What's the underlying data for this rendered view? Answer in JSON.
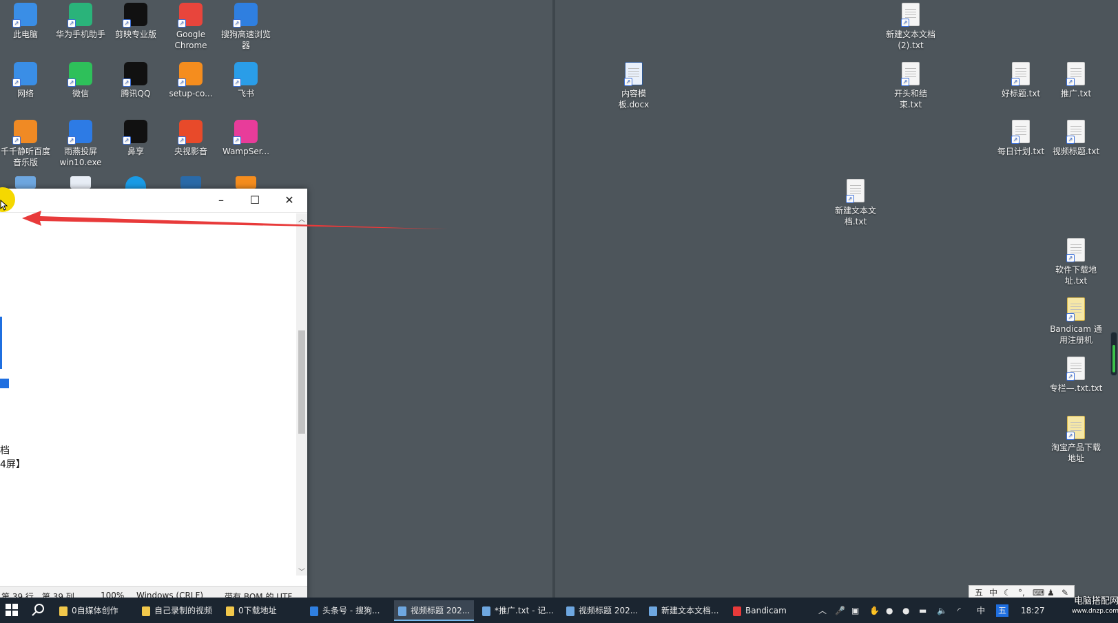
{
  "colors": {
    "desktop_left": "#4f575d",
    "desktop_right": "#4d555b",
    "taskbar": "#1b2530",
    "arrow": "#e83a3a",
    "cursor_highlight": "#f5d800",
    "accent": "#76b9ed"
  },
  "desktop_left_icons": [
    {
      "label": "此电脑",
      "icon": "computer-icon",
      "color": "#3a8ee6"
    },
    {
      "label": "华为手机助手",
      "icon": "huawei-assistant-icon",
      "color": "#2ab37a"
    },
    {
      "label": "剪映专业版",
      "icon": "jianying-icon",
      "color": "#111111"
    },
    {
      "label": "Google Chrome",
      "icon": "chrome-icon",
      "color": "#e8453c"
    },
    {
      "label": "搜狗高速浏览器",
      "icon": "sogou-browser-icon",
      "color": "#2f7fe0"
    },
    {
      "label": "网络",
      "icon": "network-icon",
      "color": "#3a8ee6"
    },
    {
      "label": "微信",
      "icon": "wechat-icon",
      "color": "#2ec05a"
    },
    {
      "label": "腾讯QQ",
      "icon": "qq-icon",
      "color": "#111111"
    },
    {
      "label": "setup-co...",
      "icon": "sublime-icon",
      "color": "#f58d1e"
    },
    {
      "label": "飞书",
      "icon": "feishu-icon",
      "color": "#2a9de8"
    },
    {
      "label": "千千静听百度音乐版",
      "icon": "ttplayer-icon",
      "color": "#f08a24"
    },
    {
      "label": "雨燕投屏win10.exe",
      "icon": "screen-cast-icon",
      "color": "#2d7be5"
    },
    {
      "label": "鼻享",
      "icon": "bixiang-icon",
      "color": "#111111"
    },
    {
      "label": "央视影音",
      "icon": "cctv-icon",
      "color": "#e84a2a"
    },
    {
      "label": "WampSer...",
      "icon": "wampserver-icon",
      "color": "#e83c9a"
    }
  ],
  "desktop_right_icons": [
    {
      "label": "新建文本文档 (2).txt",
      "icon": "text-file-icon"
    },
    {
      "label": "内容模板.docx",
      "icon": "word-doc-icon"
    },
    {
      "label": "开头和结束.txt",
      "icon": "text-file-icon"
    },
    {
      "label": "好标题.txt",
      "icon": "text-file-icon"
    },
    {
      "label": "推广.txt",
      "icon": "text-file-icon"
    },
    {
      "label": "每日计划.txt",
      "icon": "text-file-icon"
    },
    {
      "label": "视频标题.txt",
      "icon": "text-file-icon"
    },
    {
      "label": "新建文本文档.txt",
      "icon": "text-file-icon"
    },
    {
      "label": "软件下载地址.txt",
      "icon": "text-file-icon"
    },
    {
      "label": "Bandicam 通用注册机",
      "icon": "folder-shortcut-icon"
    },
    {
      "label": "专栏—.txt.txt",
      "icon": "text-file-icon"
    },
    {
      "label": "淘宝产品下载地址",
      "icon": "folder-shortcut-icon"
    }
  ],
  "notepad": {
    "minimize": "–",
    "maximize": "☐",
    "close": "✕",
    "line1": "档",
    "line2": "4屏】",
    "status": {
      "position": "第 39 行，第 39 列",
      "zoom": "100%",
      "line_ending": "Windows (CRLF)",
      "encoding": "带有 BOM 的 UTF"
    }
  },
  "taskbar": {
    "start": "windows-start-icon",
    "search": "search-icon",
    "items": [
      {
        "label": "0自媒体创作",
        "color": "#f2c84b",
        "active": false
      },
      {
        "label": "自己录制的视频",
        "color": "#f2c84b",
        "active": false
      },
      {
        "label": "0下载地址",
        "color": "#f2c84b",
        "active": false
      },
      {
        "label": "头条号 - 搜狗...",
        "color": "#2f7fe0",
        "active": false
      },
      {
        "label": "视频标题 202...",
        "color": "#6ea7e0",
        "active": true
      },
      {
        "label": "*推广.txt - 记...",
        "color": "#6ea7e0",
        "active": false
      },
      {
        "label": "视频标题 202...",
        "color": "#6ea7e0",
        "active": false
      },
      {
        "label": "新建文本文档...",
        "color": "#6ea7e0",
        "active": false
      },
      {
        "label": "Bandicam",
        "color": "#e83a3a",
        "active": false
      }
    ],
    "tray_ime": "中",
    "tray_ime2": "五",
    "clock": "18:27"
  },
  "ime_bar": {
    "items": [
      "五",
      "中",
      "☾",
      "°,",
      "⌨",
      "♟",
      "✎"
    ]
  },
  "watermark": {
    "line1": "电脑搭配网",
    "line2": "www.dnzp.com"
  }
}
